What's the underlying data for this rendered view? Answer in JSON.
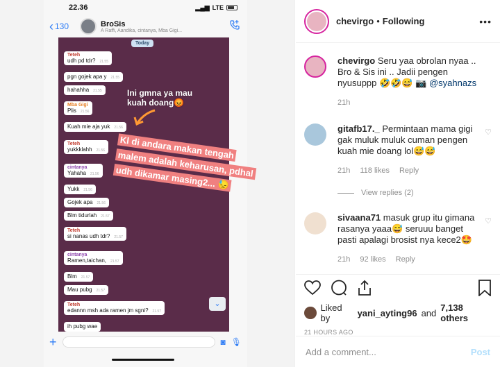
{
  "phone": {
    "time": "22.36",
    "network": "LTE",
    "back_count": "130",
    "group_name": "BroSis",
    "group_members": "A Raffi, Aandika, cintanya, Mba Gigi...",
    "today": "Today"
  },
  "chat_messages": [
    {
      "sender": "Teteh",
      "text": "udh pd tdr?",
      "time": "21.55"
    },
    {
      "sender": "",
      "text": "pgn gojek apa y",
      "time": "21.55"
    },
    {
      "sender": "",
      "text": "hahahha",
      "time": "21.55"
    },
    {
      "sender": "Mba Gigi",
      "text": "Plis",
      "time": "21.56"
    },
    {
      "sender": "",
      "text": "Kuah mie aja yuk",
      "time": "21.56"
    },
    {
      "sender": "Teteh",
      "text": "yukkklahh",
      "time": "21.56"
    },
    {
      "sender": "cintanya",
      "text": "Yahaha",
      "time": "21.56"
    },
    {
      "sender": "",
      "text": "Yukk",
      "time": "21.56"
    },
    {
      "sender": "",
      "text": "Gojek apa",
      "time": "21.56"
    },
    {
      "sender": "",
      "text": "Blm tidurlah",
      "time": "21.57"
    },
    {
      "sender": "Teteh",
      "text": "si nanas udh tdr?",
      "time": "21.57"
    },
    {
      "sender": "cintanya",
      "text": "Ramen,taichan,",
      "time": "21.57"
    },
    {
      "sender": "",
      "text": "Blm",
      "time": "21.57"
    },
    {
      "sender": "",
      "text": "Mau pubg",
      "time": "21.57"
    },
    {
      "sender": "Teteh",
      "text": "edannn msh ada ramen jm sgni?",
      "time": "21.57"
    },
    {
      "sender": "",
      "text": "ih pubg wae",
      "time": ""
    }
  ],
  "overlay": {
    "note": "Ini gmna ya mau kuah doang😡",
    "caption": "Kl di andara makan tengah malem adalah keharusan, pdhal udh dikamar masing2... 😓"
  },
  "post": {
    "username": "chevirgo",
    "follow_status": "Following",
    "caption_user": "chevirgo",
    "caption_text": "Seru yaa obrolan nyaa .. Bro & Sis ini .. Jadii pengen nyusuppp 🤣🤣😅 📷",
    "caption_mention": "@syahnazs",
    "caption_time": "21h",
    "comments": [
      {
        "user": "gitafb17._",
        "text": "Permintaan mama gigi gak muluk muluk cuman pengen kuah mie doang lol😅😅",
        "time": "21h",
        "likes": "118 likes",
        "reply": "Reply"
      },
      {
        "user": "sivaana71",
        "text": "masuk grup itu gimana rasanya yaaa😅 seruuu banget pasti apalagi brosist nya kece2🤩",
        "time": "21h",
        "likes": "92 likes",
        "reply": "Reply"
      }
    ],
    "view_replies": "View replies (2)",
    "liked_by_prefix": "Liked by",
    "liked_by_user": "yani_ayting96",
    "liked_by_and": "and",
    "liked_by_others": "7,138 others",
    "time_ago": "21 HOURS AGO",
    "add_comment_placeholder": "Add a comment...",
    "post_label": "Post"
  }
}
